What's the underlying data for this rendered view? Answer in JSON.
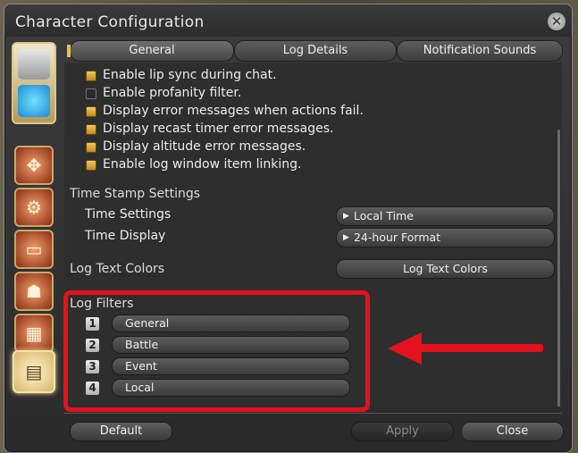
{
  "window": {
    "title": "Character Configuration"
  },
  "tabs": [
    {
      "label": "General",
      "active": true
    },
    {
      "label": "Log Details",
      "active": false
    },
    {
      "label": "Notification Sounds",
      "active": false
    }
  ],
  "options": [
    {
      "label": "Enable lip sync during chat.",
      "checked": true
    },
    {
      "label": "Enable profanity filter.",
      "checked": false
    },
    {
      "label": "Display error messages when actions fail.",
      "checked": true
    },
    {
      "label": "Display recast timer error messages.",
      "checked": true
    },
    {
      "label": "Display altitude error messages.",
      "checked": true
    },
    {
      "label": "Enable log window item linking.",
      "checked": true
    }
  ],
  "timestamp": {
    "heading": "Time Stamp Settings",
    "time_settings_label": "Time Settings",
    "time_settings_value": "Local Time",
    "time_display_label": "Time Display",
    "time_display_value": "24-hour Format"
  },
  "log_text_colors": {
    "heading": "Log Text Colors",
    "button": "Log Text Colors"
  },
  "log_filters": {
    "heading": "Log Filters",
    "items": [
      {
        "num": "1",
        "label": "General"
      },
      {
        "num": "2",
        "label": "Battle"
      },
      {
        "num": "3",
        "label": "Event"
      },
      {
        "num": "4",
        "label": "Local"
      }
    ]
  },
  "footer": {
    "default": "Default",
    "apply": "Apply",
    "close": "Close"
  },
  "annotation": {
    "color": "#e3121e"
  }
}
